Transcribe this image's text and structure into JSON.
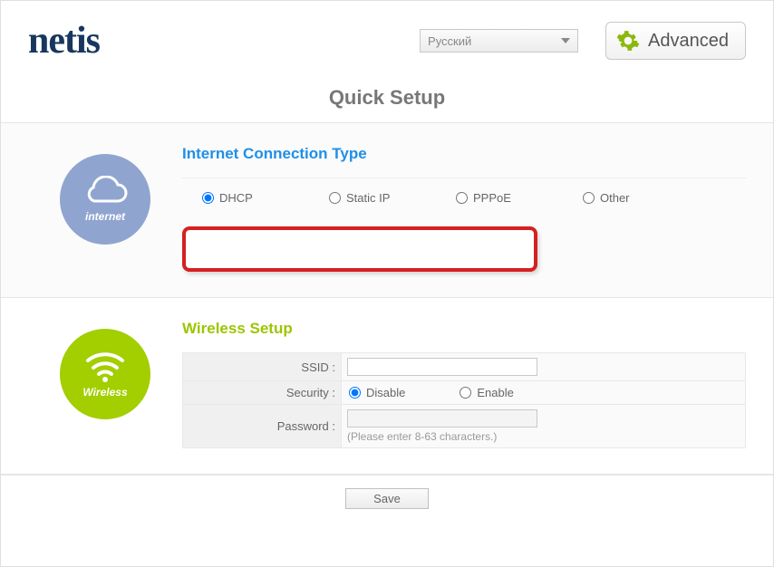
{
  "brand": "netis",
  "language": {
    "selected": "Русский"
  },
  "advanced_label": "Advanced",
  "page_title": "Quick Setup",
  "internet": {
    "title": "Internet Connection Type",
    "icon_label": "internet",
    "options": {
      "dhcp": "DHCP",
      "static": "Static IP",
      "pppoe": "PPPoE",
      "other": "Other"
    },
    "selected": "dhcp"
  },
  "wireless": {
    "title": "Wireless Setup",
    "icon_label": "Wireless",
    "ssid_label": "SSID :",
    "ssid_value": "",
    "security_label": "Security :",
    "security_options": {
      "disable": "Disable",
      "enable": "Enable"
    },
    "security_selected": "disable",
    "password_label": "Password :",
    "password_value": "",
    "password_hint": "(Please enter 8-63 characters.)"
  },
  "save_label": "Save"
}
